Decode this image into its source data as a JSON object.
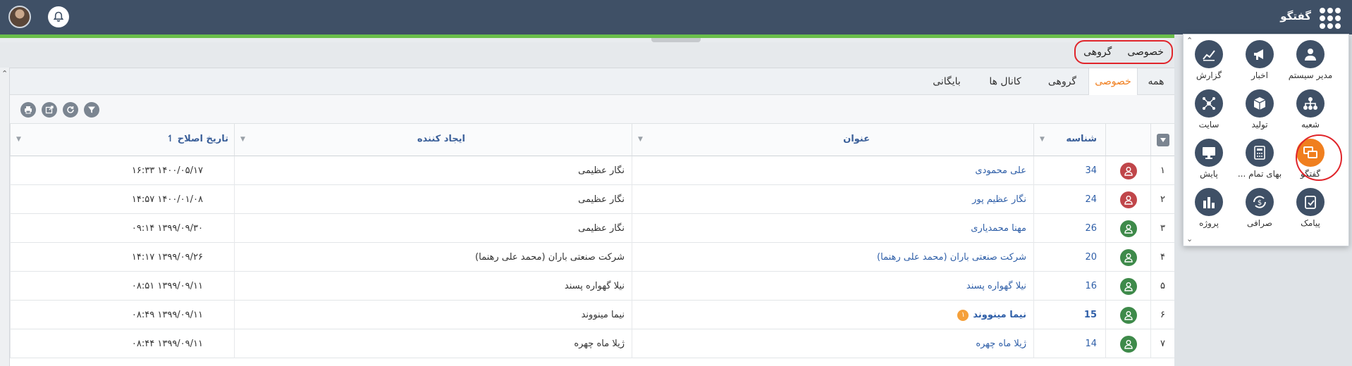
{
  "header": {
    "app_title": "گفتگو"
  },
  "quick_tabs": {
    "private": "خصوصی",
    "group": "گروهی"
  },
  "tabs": [
    {
      "label": "همه"
    },
    {
      "label": "خصوصی"
    },
    {
      "label": "گروهی"
    },
    {
      "label": "کانال ها"
    },
    {
      "label": "بایگانی"
    }
  ],
  "table": {
    "columns": {
      "id": "شناسه",
      "title": "عنوان",
      "creator": "ایجاد کننده",
      "modified": "تاریخ اصلاح"
    },
    "rows": [
      {
        "num": "۱",
        "id": "34",
        "title": "علی محمودی",
        "creator": "نگار عظیمی",
        "modified": "۱۴۰۰/۰۵/۱۷ ۱۶:۳۳",
        "avatar": "#c0464a",
        "bold": false,
        "badge": ""
      },
      {
        "num": "۲",
        "id": "24",
        "title": "نگار عظیم پور",
        "creator": "نگار عظیمی",
        "modified": "۱۴۰۰/۰۱/۰۸ ۱۴:۵۷",
        "avatar": "#c0464a",
        "bold": false,
        "badge": ""
      },
      {
        "num": "۳",
        "id": "26",
        "title": "مهنا محمدیاری",
        "creator": "نگار عظیمی",
        "modified": "۱۳۹۹/۰۹/۳۰ ۰۹:۱۴",
        "avatar": "#3e8a4a",
        "bold": false,
        "badge": ""
      },
      {
        "num": "۴",
        "id": "20",
        "title": "شرکت صنعتی باران (محمد علی رهنما)",
        "creator": "شرکت صنعتی باران (محمد علی رهنما)",
        "modified": "۱۳۹۹/۰۹/۲۶ ۱۴:۱۷",
        "avatar": "#3e8a4a",
        "bold": false,
        "badge": ""
      },
      {
        "num": "۵",
        "id": "16",
        "title": "نیلا گهواره پسند",
        "creator": "نیلا گهواره پسند",
        "modified": "۱۳۹۹/۰۹/۱۱ ۰۸:۵۱",
        "avatar": "#3e8a4a",
        "bold": false,
        "badge": ""
      },
      {
        "num": "۶",
        "id": "15",
        "title": "نیما مینووند",
        "creator": "نیما مینووند",
        "modified": "۱۳۹۹/۰۹/۱۱ ۰۸:۴۹",
        "avatar": "#3e8a4a",
        "bold": true,
        "badge": "۱"
      },
      {
        "num": "۷",
        "id": "14",
        "title": "ژیلا ماه چهره",
        "creator": "ژیلا ماه چهره",
        "modified": "۱۳۹۹/۰۹/۱۱ ۰۸:۴۴",
        "avatar": "#3e8a4a",
        "bold": false,
        "badge": ""
      }
    ]
  },
  "drawer": {
    "apps": [
      {
        "label": "مدیر سیستم",
        "icon": "admin-icon"
      },
      {
        "label": "اخبار",
        "icon": "megaphone-icon"
      },
      {
        "label": "گزارش",
        "icon": "report-icon"
      },
      {
        "label": "شعبه",
        "icon": "branch-icon"
      },
      {
        "label": "تولید",
        "icon": "box-icon"
      },
      {
        "label": "سایت",
        "icon": "network-icon"
      },
      {
        "label": "گفتگو",
        "icon": "chat-icon"
      },
      {
        "label": "بهای تمام ...",
        "icon": "calculator-icon"
      },
      {
        "label": "پایش",
        "icon": "monitor-icon"
      },
      {
        "label": "پیامک",
        "icon": "sms-icon"
      },
      {
        "label": "صرافی",
        "icon": "exchange-icon"
      },
      {
        "label": "پروژه",
        "icon": "chart-bars-icon"
      }
    ]
  },
  "colors": {
    "topbar": "#3f5066",
    "accent": "#f07f1f",
    "link": "#2f5fa8",
    "highlight": "#e0252b"
  }
}
